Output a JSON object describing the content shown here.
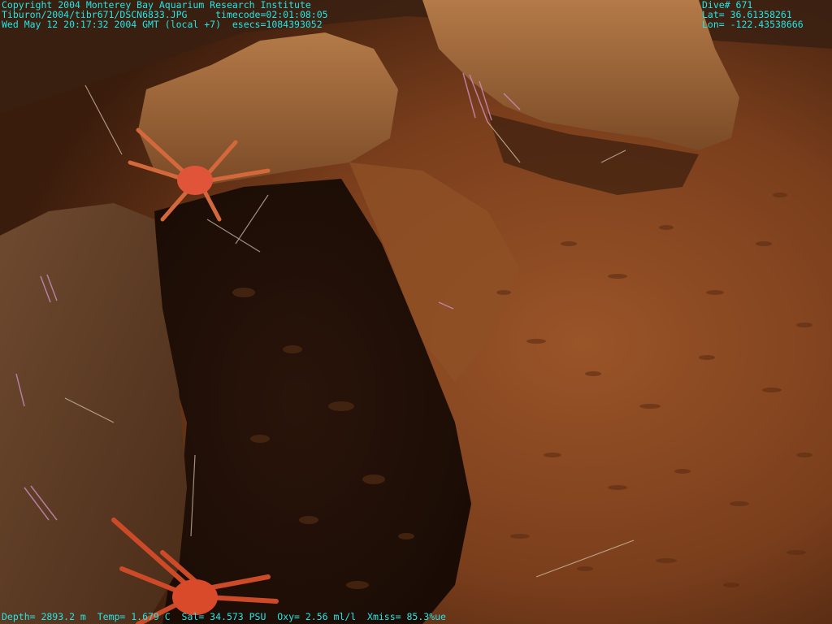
{
  "overlay": {
    "top_left": [
      "Copyright 2004 Monterey Bay Aquarium Research Institute",
      "Tiburon/2004/tibr671/DSCN6833.JPG     timecode=02:01:08:05",
      "Wed May 12 20:17:32 2004 GMT (local +7)  esecs=1084393052"
    ],
    "top_right": [
      "Dive# 671",
      "Lat= 36.61358261",
      "Lon= -122.43538666"
    ],
    "bottom": "Depth= 2893.2 m  Temp= 1.679 C  Sal= 34.573 PSU  Oxy= 2.56 ml/l  Xmiss= 85.3%ue"
  },
  "colors": {
    "overlay_text": "#22e6e6",
    "sediment": "#8a4a22",
    "rock": "#a86a3c",
    "shadow": "#1e0f08",
    "crab": "#d2502c"
  }
}
